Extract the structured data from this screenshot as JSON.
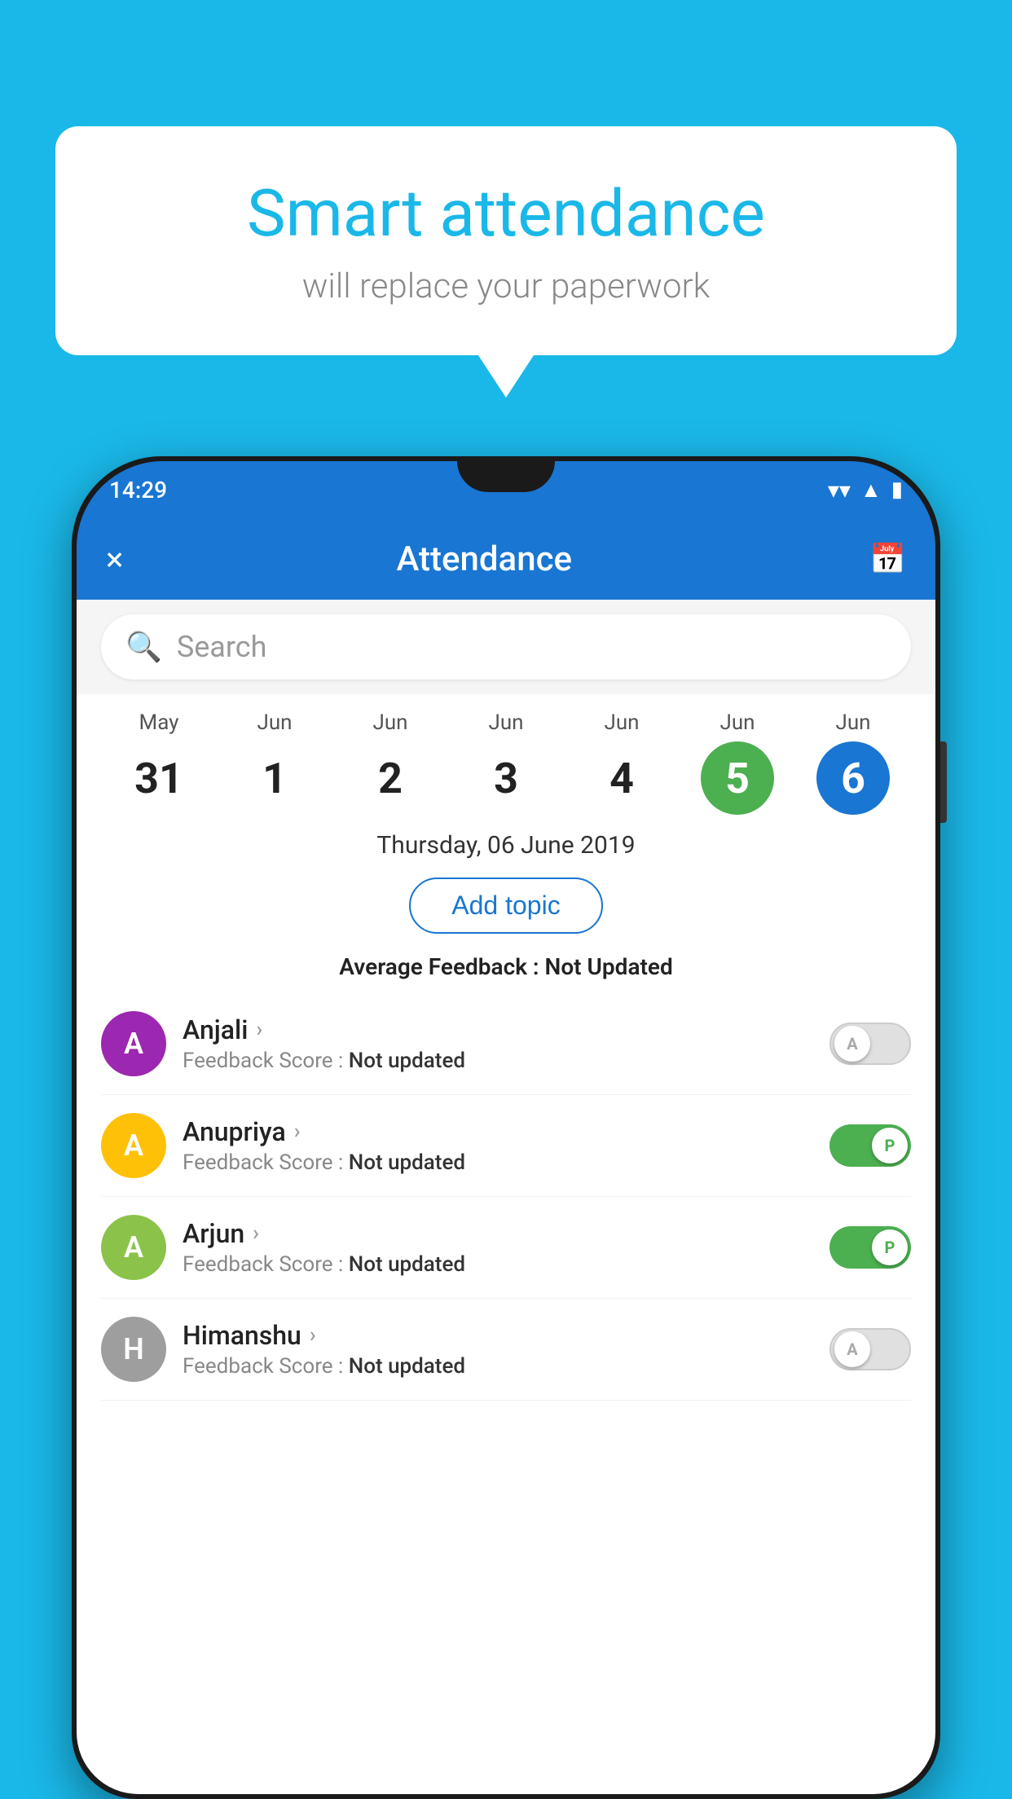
{
  "background_color": "#1ab8e8",
  "speech_bubble": {
    "title": "Smart attendance",
    "subtitle": "will replace your paperwork"
  },
  "status_bar": {
    "time": "14:29",
    "icons": [
      "wifi",
      "signal",
      "battery"
    ]
  },
  "app_bar": {
    "title": "Attendance",
    "close_label": "×",
    "calendar_icon": "calendar"
  },
  "search": {
    "placeholder": "Search"
  },
  "calendar": {
    "days": [
      {
        "month": "May",
        "date": "31",
        "style": "normal"
      },
      {
        "month": "Jun",
        "date": "1",
        "style": "normal"
      },
      {
        "month": "Jun",
        "date": "2",
        "style": "normal"
      },
      {
        "month": "Jun",
        "date": "3",
        "style": "normal"
      },
      {
        "month": "Jun",
        "date": "4",
        "style": "normal"
      },
      {
        "month": "Jun",
        "date": "5",
        "style": "today"
      },
      {
        "month": "Jun",
        "date": "6",
        "style": "selected"
      }
    ],
    "selected_date": "Thursday, 06 June 2019"
  },
  "add_topic_label": "Add topic",
  "avg_feedback_label": "Average Feedback :",
  "avg_feedback_value": "Not Updated",
  "students": [
    {
      "name": "Anjali",
      "avatar_letter": "A",
      "avatar_color": "#9c27b0",
      "feedback_label": "Feedback Score :",
      "feedback_value": "Not updated",
      "toggle": "off",
      "toggle_letter": "A"
    },
    {
      "name": "Anupriya",
      "avatar_letter": "A",
      "avatar_color": "#ffc107",
      "feedback_label": "Feedback Score :",
      "feedback_value": "Not updated",
      "toggle": "on",
      "toggle_letter": "P"
    },
    {
      "name": "Arjun",
      "avatar_letter": "A",
      "avatar_color": "#8bc34a",
      "feedback_label": "Feedback Score :",
      "feedback_value": "Not updated",
      "toggle": "on",
      "toggle_letter": "P"
    },
    {
      "name": "Himanshu",
      "avatar_letter": "H",
      "avatar_color": "#9e9e9e",
      "feedback_label": "Feedback Score :",
      "feedback_value": "Not updated",
      "toggle": "off",
      "toggle_letter": "A"
    }
  ]
}
